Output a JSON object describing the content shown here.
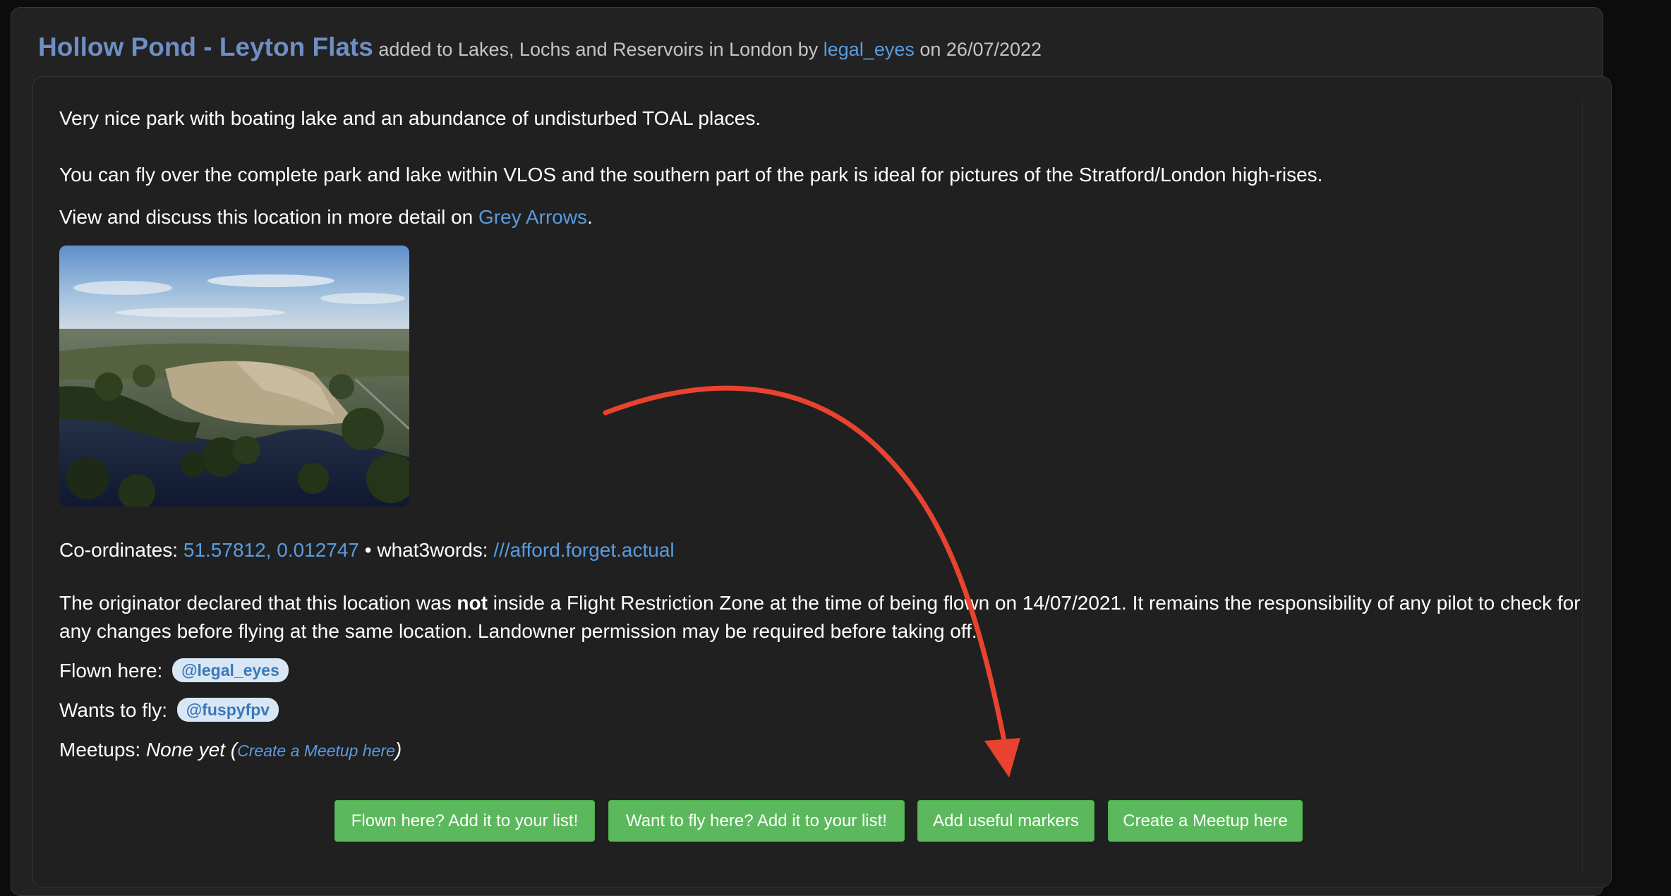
{
  "header": {
    "title": "Hollow Pond - Leyton Flats",
    "added_prefix": " added to ",
    "category": "Lakes, Lochs and Reservoirs in London",
    "by_text": " by ",
    "author": "legal_eyes",
    "on_text": " on ",
    "date": "26/07/2022"
  },
  "description": {
    "line1": "Very nice park with boating lake and an abundance of undisturbed TOAL places.",
    "line2": "You can fly over the complete park and lake within VLOS and the southern part of the park is ideal for pictures of the Stratford/London high-rises."
  },
  "discuss": {
    "prefix": "View and discuss this location in more detail on ",
    "link_text": "Grey Arrows",
    "suffix": "."
  },
  "coordinates": {
    "label": "Co-ordinates: ",
    "value": "51.57812, 0.012747",
    "separator": " • what3words: ",
    "what3words": "///afford.forget.actual"
  },
  "restriction": {
    "part1": "The originator declared that this location was ",
    "bold": "not",
    "part2": " inside a Flight Restriction Zone at the time of being flown on 14/07/2021. It remains the responsibility of any pilot to check for any changes before flying at the same location. Landowner permission may be required before taking off."
  },
  "flown_here": {
    "label": "Flown here:",
    "user": "@legal_eyes"
  },
  "wants_to_fly": {
    "label": "Wants to fly:",
    "user": "@fuspyfpv"
  },
  "meetups": {
    "label": "Meetups: ",
    "value": "None yet",
    "open_paren": " (",
    "link_text": "Create a Meetup here",
    "close_paren": ")"
  },
  "buttons": {
    "flown": "Flown here? Add it to your list!",
    "want": "Want to fly here? Add it to your list!",
    "markers": "Add useful markers",
    "meetup": "Create a Meetup here"
  },
  "colors": {
    "link": "#5b9bde",
    "title": "#6f8fc4",
    "button": "#5cb85c",
    "annotation_arrow": "#e8432e"
  }
}
